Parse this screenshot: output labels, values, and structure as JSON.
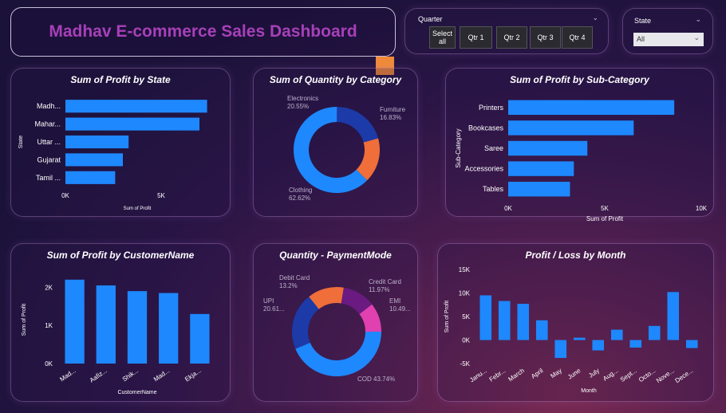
{
  "header": {
    "title": "Madhav E-commerce Sales Dashboard"
  },
  "slicers": {
    "quarter": {
      "label": "Quarter",
      "options": [
        "Select all",
        "Qtr 1",
        "Qtr 2",
        "Qtr 3",
        "Qtr 4"
      ]
    },
    "state": {
      "label": "State",
      "selected": "All"
    }
  },
  "colors": {
    "bar": "#1e88ff",
    "title": "#a640b8"
  },
  "chart_data": [
    {
      "id": "profit_by_state",
      "type": "bar",
      "orientation": "horizontal",
      "title": "Sum of Profit by State",
      "xlabel": "Sum of Profit",
      "ylabel": "State",
      "categories": [
        "Madh...",
        "Mahar...",
        "Uttar ...",
        "Gujarat",
        "Tamil ..."
      ],
      "values": [
        7400,
        7000,
        3300,
        3000,
        2600
      ],
      "xlim": [
        0,
        7500
      ],
      "xticks": [
        0,
        5000
      ],
      "xtick_labels": [
        "0K",
        "5K"
      ]
    },
    {
      "id": "quantity_by_category",
      "type": "pie",
      "donut": true,
      "title": "Sum of Quantity by Category",
      "slices": [
        {
          "label": "Clothing",
          "pct": "62.62%",
          "value": 62.62,
          "color": "#1e88ff"
        },
        {
          "label": "Electronics",
          "pct": "20.55%",
          "value": 20.55,
          "color": "#1c3aa8"
        },
        {
          "label": "Furniture",
          "pct": "16.83%",
          "value": 16.83,
          "color": "#ef6e3a"
        }
      ]
    },
    {
      "id": "profit_by_subcategory",
      "type": "bar",
      "orientation": "horizontal",
      "title": "Sum of Profit by Sub-Category",
      "xlabel": "Sum of Profit",
      "ylabel": "Sub-Category",
      "categories": [
        "Printers",
        "Bookcases",
        "Saree",
        "Accessories",
        "Tables"
      ],
      "values": [
        8600,
        6500,
        4100,
        3400,
        3200
      ],
      "xlim": [
        0,
        10000
      ],
      "xticks": [
        0,
        5000,
        10000
      ],
      "xtick_labels": [
        "0K",
        "5K",
        "10K"
      ]
    },
    {
      "id": "profit_by_customer",
      "type": "bar",
      "orientation": "vertical",
      "title": "Sum of Profit by CustomerName",
      "xlabel": "CustomerName",
      "ylabel": "Sum of Profit",
      "categories": [
        "Mad...",
        "Aafiz...",
        "Shik...",
        "Mad...",
        "Ekja..."
      ],
      "values": [
        2200,
        2050,
        1900,
        1850,
        1300
      ],
      "ylim": [
        0,
        2300
      ],
      "yticks": [
        0,
        1000,
        2000
      ],
      "ytick_labels": [
        "0K",
        "1K",
        "2K"
      ]
    },
    {
      "id": "quantity_paymentmode",
      "type": "pie",
      "donut": true,
      "title": "Quantity - PaymentMode",
      "slices": [
        {
          "label": "COD",
          "pct": "43.74%",
          "value": 43.74,
          "color": "#1e88ff"
        },
        {
          "label": "UPI",
          "pct": "20.61...",
          "value": 20.61,
          "color": "#1c3aa8"
        },
        {
          "label": "Debit Card",
          "pct": "13.2%",
          "value": 13.2,
          "color": "#ef6e3a"
        },
        {
          "label": "Credit Card",
          "pct": "11.97%",
          "value": 11.97,
          "color": "#6a1a80"
        },
        {
          "label": "EMI",
          "pct": "10.49...",
          "value": 10.49,
          "color": "#e040b0"
        }
      ]
    },
    {
      "id": "profit_loss_by_month",
      "type": "bar",
      "orientation": "vertical",
      "title": "Profit / Loss by Month",
      "xlabel": "Month",
      "ylabel": "Sum of Profit",
      "categories": [
        "Janu...",
        "Febr...",
        "March",
        "April",
        "May",
        "June",
        "July",
        "Aug...",
        "Sept...",
        "Octo...",
        "Nove...",
        "Dece..."
      ],
      "values": [
        9500,
        8300,
        7700,
        4200,
        -3800,
        500,
        -2200,
        2200,
        -1600,
        3000,
        10200,
        -1700
      ],
      "ylim": [
        -5000,
        15000
      ],
      "yticks": [
        -5000,
        0,
        5000,
        10000,
        15000
      ],
      "ytick_labels": [
        "-5K",
        "0K",
        "5K",
        "10K",
        "15K"
      ]
    }
  ]
}
